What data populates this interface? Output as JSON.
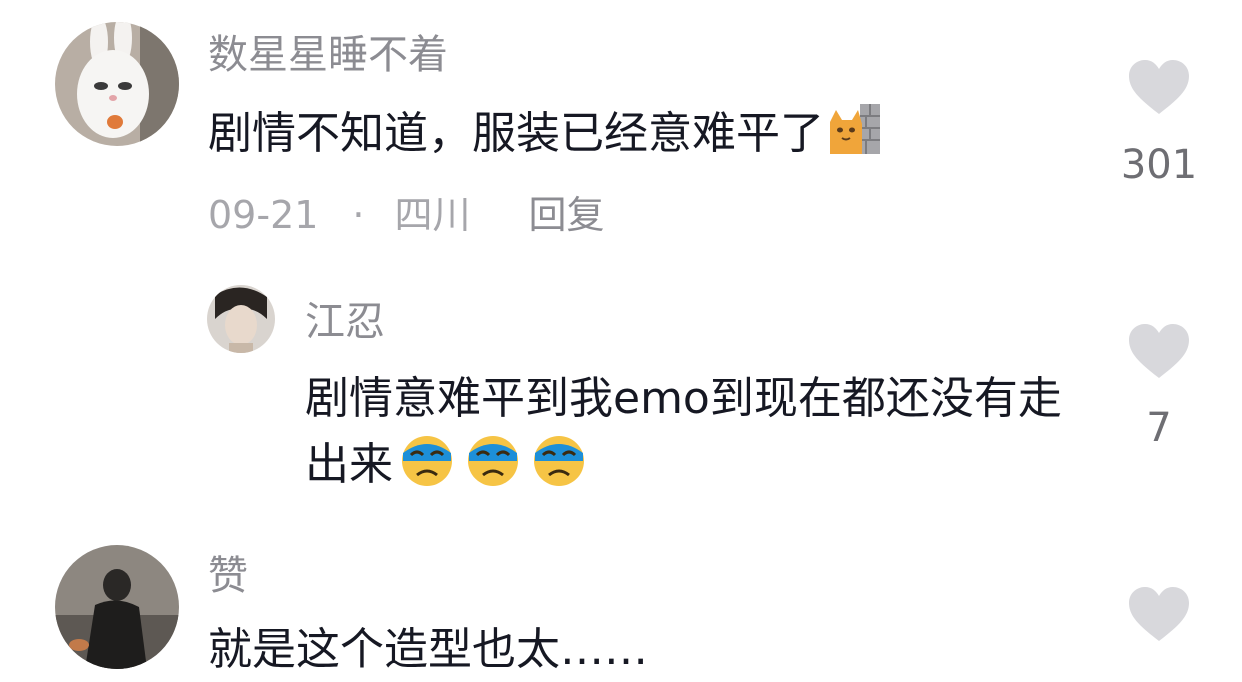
{
  "comments": [
    {
      "username": "数星星睡不着",
      "text": "剧情不知道，服装已经意难平了",
      "emoji": "cat-wall-emoji",
      "date": "09-21",
      "separator": "·",
      "location": "四川",
      "reply_label": "回复",
      "likes": "301"
    },
    {
      "username": "江忍",
      "text": "剧情意难平到我emo到现在都还没有走出来",
      "emoji": "crying-face-emoji",
      "emoji_count": 3,
      "likes": "7"
    },
    {
      "username": "赞",
      "text": "就是这个造型也太……"
    }
  ],
  "colors": {
    "username": "#8c8c92",
    "text": "#161823",
    "meta": "#a6a6ab",
    "heart": "#d8d8dc"
  }
}
